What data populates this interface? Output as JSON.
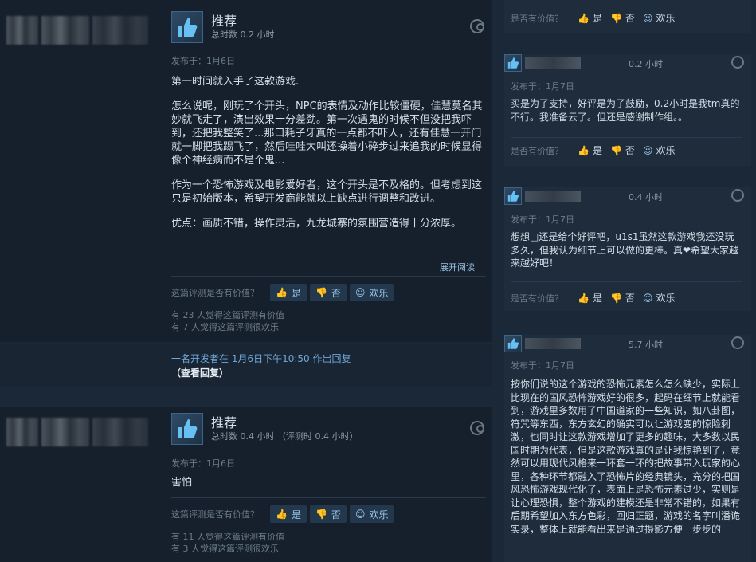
{
  "review1": {
    "recommend": "推荐",
    "hours": "总时数 0.2 小时",
    "posted": "发布于：1月6日",
    "paragraphs": [
      "第一时间就入手了这款游戏.",
      "怎么说呢，刚玩了个开头，NPC的表情及动作比较僵硬，佳慧莫名其妙就飞走了，演出效果十分差劲。第一次遇鬼的时候不但没把我吓到，还把我整笑了...那口耗子牙真的一点都不吓人，还有佳慧一开门就一脚把我踢飞了，然后哇哇大叫还操着小碎步过来追我的时候显得像个神经病而不是个鬼...",
      "作为一个恐怖游戏及电影爱好者，这个开头是不及格的。但考虑到这只是初始版本，希望开发商能就以上缺点进行调整和改进。",
      "优点：画质不错，操作灵活，九龙城寨的氛围营造得十分浓厚。"
    ],
    "expand": "展开阅读",
    "helpful_q": "这篇评测是否有价值？",
    "yes": "是",
    "no": "否",
    "funny": "欢乐",
    "helpful_count": "有 23 人觉得这篇评测有价值",
    "funny_count": "有 7 人觉得这篇评测很欢乐"
  },
  "dev_reply": {
    "line": "一名开发者在 1月6日下午10:50 作出回复",
    "view": "（查看回复）"
  },
  "review2": {
    "recommend": "推荐",
    "hours": "总时数 0.4 小时 （评测时 0.4 小时）",
    "posted": "发布于：1月6日",
    "text": "害怕",
    "helpful_q": "这篇评测是否有价值？",
    "yes": "是",
    "no": "否",
    "funny": "欢乐",
    "helpful_count": "有 11 人觉得这篇评测有价值",
    "funny_count": "有 3 人觉得这篇评测很欢乐"
  },
  "side": {
    "top_vote": {
      "q": "是否有价值？",
      "yes": "是",
      "no": "否",
      "funny": "欢乐"
    },
    "cards": [
      {
        "hours": "0.2 小时",
        "posted": "发布于：1月7日",
        "text": "买是为了支持，好评是为了鼓励，0.2小时是我tm真的不行。我准备云了。但还是感谢制作组。。",
        "q": "是否有价值？",
        "yes": "是",
        "no": "否",
        "funny": "欢乐"
      },
      {
        "hours": "0.4 小时",
        "posted": "发布于：1月7日",
        "text": "想想□还是给个好评吧，u1s1虽然这款游戏我还没玩多久，但我认为细节上可以做的更棒。真❤希望大家越来越好吧！",
        "q": "是否有价值？",
        "yes": "是",
        "no": "否",
        "funny": "欢乐"
      },
      {
        "hours": "5.7 小时",
        "posted": "发布于：1月7日",
        "text": "按你们说的这个游戏的恐怖元素怎么怎么缺少，实际上比现在的国风恐怖游戏好的很多，起码在细节上就能看到，游戏里多数用了中国道家的一些知识，如八卦图，符咒等东西，东方玄幻的确实可以让游戏变的惊险刺激，也同时让这款游戏增加了更多的趣味，大多数以民国时期为代表，但是这款游戏真的是让我惊艳到了，竟然可以用现代风格来一环套一环的把故事带入玩家的心里，各种环节都融入了恐怖片的经典镜头，充分的把国风恐怖游戏现代化了，表面上是恐怖元素过少，实则是让心理恐惧，整个游戏的建模还是非常不错的，如果有后期希望加入东方色彩，回归正题，游戏的名字叫潘诡实录，整体上就能看出来是通过摄影方便一步步的"
      }
    ]
  }
}
